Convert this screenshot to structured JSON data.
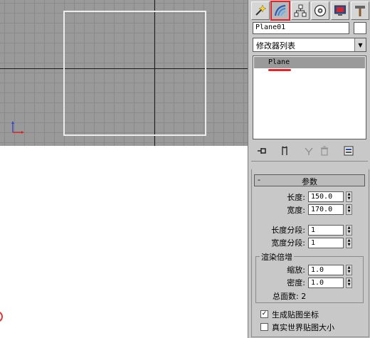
{
  "panel": {
    "tabs": [
      {
        "icon": "create-icon"
      },
      {
        "icon": "modify-icon",
        "active": true
      },
      {
        "icon": "hierarchy-icon"
      },
      {
        "icon": "motion-icon"
      },
      {
        "icon": "display-icon"
      },
      {
        "icon": "utilities-icon"
      }
    ],
    "object_name": "Plane01",
    "modifier_list": "修改器列表",
    "stack_item": "Plane",
    "rollout_title": "参数",
    "rollout_toggle": "-",
    "params": {
      "length_label": "长度:",
      "length_value": "150.0",
      "width_label": "宽度:",
      "width_value": "170.0",
      "length_segs_label": "长度分段:",
      "length_segs_value": "1",
      "width_segs_label": "宽度分段:",
      "width_segs_value": "1"
    },
    "render_group": {
      "title": "渲染倍增",
      "scale_label": "缩放:",
      "scale_value": "1.0",
      "density_label": "密度:",
      "density_value": "1.0",
      "total_faces": "总面数: 2"
    },
    "gen_mapping_label": "生成贴图坐标",
    "gen_mapping_checked": true,
    "real_world_label": "真实世界贴图大小",
    "real_world_checked": false
  },
  "colors": {
    "highlight": "#e0262c",
    "viewport_bg": "#9a9a9a"
  }
}
